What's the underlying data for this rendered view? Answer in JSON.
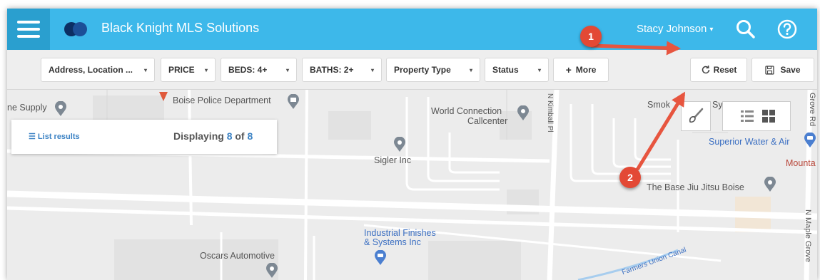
{
  "header": {
    "app_title": "Black Knight MLS Solutions",
    "user_name": "Stacy Johnson",
    "user_caret": "▾"
  },
  "filters": {
    "location_label": "Address, Location ...",
    "price_label": "PRICE",
    "beds_label": "BEDS: 4+",
    "baths_label": "BATHS: 2+",
    "property_type_label": "Property Type",
    "status_label": "Status",
    "more_label": "More",
    "more_prefix": "+",
    "reset_label": "Reset",
    "save_label": "Save",
    "dropdown_caret": "▾"
  },
  "results": {
    "list_label": "List results",
    "displaying_prefix": "Displaying",
    "shown": "8",
    "of_word": "of",
    "total": "8"
  },
  "map_labels": {
    "supply": "ne Supply",
    "police": "Boise Police Department",
    "world_connection_1": "World Connection",
    "world_connection_2": "Callcenter",
    "kimball": "N Kimball Pl",
    "smok": "Smok",
    "sy": "Sy",
    "grove_rd": "Grove Rd",
    "sigler": "Sigler Inc",
    "superior": "Superior Water & Air",
    "mounta": "Mounta",
    "base_jiu_jitsu": "The Base Jiu Jitsu Boise",
    "maple_grove": "N Maple Grove",
    "industrial_1": "Industrial Finishes",
    "industrial_2": "& Systems Inc",
    "oscars": "Oscars Automotive",
    "canal": "Farmers Union Canal"
  },
  "annotations": {
    "callout_1": "1",
    "callout_2": "2"
  },
  "colors": {
    "header_bg": "#3db8ea",
    "menu_bg": "#2a9fcf",
    "link_blue": "#3b82c4",
    "callout_red": "#e34935",
    "arrow_red": "#e7553f"
  }
}
